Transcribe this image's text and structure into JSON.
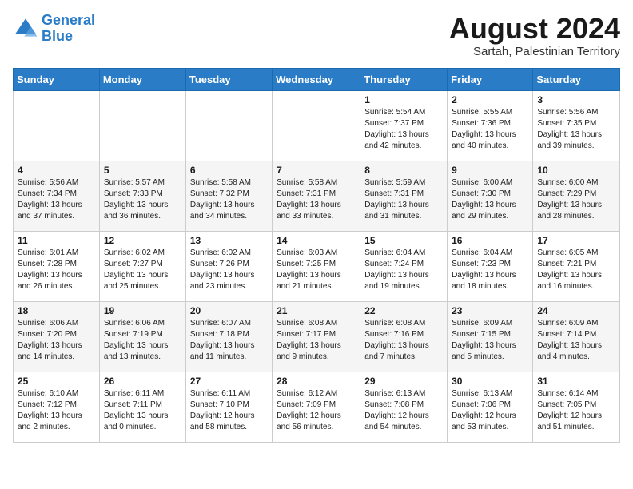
{
  "logo": {
    "line1": "General",
    "line2": "Blue"
  },
  "title": "August 2024",
  "subtitle": "Sartah, Palestinian Territory",
  "weekdays": [
    "Sunday",
    "Monday",
    "Tuesday",
    "Wednesday",
    "Thursday",
    "Friday",
    "Saturday"
  ],
  "weeks": [
    [
      {
        "day": "",
        "info": ""
      },
      {
        "day": "",
        "info": ""
      },
      {
        "day": "",
        "info": ""
      },
      {
        "day": "",
        "info": ""
      },
      {
        "day": "1",
        "info": "Sunrise: 5:54 AM\nSunset: 7:37 PM\nDaylight: 13 hours\nand 42 minutes."
      },
      {
        "day": "2",
        "info": "Sunrise: 5:55 AM\nSunset: 7:36 PM\nDaylight: 13 hours\nand 40 minutes."
      },
      {
        "day": "3",
        "info": "Sunrise: 5:56 AM\nSunset: 7:35 PM\nDaylight: 13 hours\nand 39 minutes."
      }
    ],
    [
      {
        "day": "4",
        "info": "Sunrise: 5:56 AM\nSunset: 7:34 PM\nDaylight: 13 hours\nand 37 minutes."
      },
      {
        "day": "5",
        "info": "Sunrise: 5:57 AM\nSunset: 7:33 PM\nDaylight: 13 hours\nand 36 minutes."
      },
      {
        "day": "6",
        "info": "Sunrise: 5:58 AM\nSunset: 7:32 PM\nDaylight: 13 hours\nand 34 minutes."
      },
      {
        "day": "7",
        "info": "Sunrise: 5:58 AM\nSunset: 7:31 PM\nDaylight: 13 hours\nand 33 minutes."
      },
      {
        "day": "8",
        "info": "Sunrise: 5:59 AM\nSunset: 7:31 PM\nDaylight: 13 hours\nand 31 minutes."
      },
      {
        "day": "9",
        "info": "Sunrise: 6:00 AM\nSunset: 7:30 PM\nDaylight: 13 hours\nand 29 minutes."
      },
      {
        "day": "10",
        "info": "Sunrise: 6:00 AM\nSunset: 7:29 PM\nDaylight: 13 hours\nand 28 minutes."
      }
    ],
    [
      {
        "day": "11",
        "info": "Sunrise: 6:01 AM\nSunset: 7:28 PM\nDaylight: 13 hours\nand 26 minutes."
      },
      {
        "day": "12",
        "info": "Sunrise: 6:02 AM\nSunset: 7:27 PM\nDaylight: 13 hours\nand 25 minutes."
      },
      {
        "day": "13",
        "info": "Sunrise: 6:02 AM\nSunset: 7:26 PM\nDaylight: 13 hours\nand 23 minutes."
      },
      {
        "day": "14",
        "info": "Sunrise: 6:03 AM\nSunset: 7:25 PM\nDaylight: 13 hours\nand 21 minutes."
      },
      {
        "day": "15",
        "info": "Sunrise: 6:04 AM\nSunset: 7:24 PM\nDaylight: 13 hours\nand 19 minutes."
      },
      {
        "day": "16",
        "info": "Sunrise: 6:04 AM\nSunset: 7:23 PM\nDaylight: 13 hours\nand 18 minutes."
      },
      {
        "day": "17",
        "info": "Sunrise: 6:05 AM\nSunset: 7:21 PM\nDaylight: 13 hours\nand 16 minutes."
      }
    ],
    [
      {
        "day": "18",
        "info": "Sunrise: 6:06 AM\nSunset: 7:20 PM\nDaylight: 13 hours\nand 14 minutes."
      },
      {
        "day": "19",
        "info": "Sunrise: 6:06 AM\nSunset: 7:19 PM\nDaylight: 13 hours\nand 13 minutes."
      },
      {
        "day": "20",
        "info": "Sunrise: 6:07 AM\nSunset: 7:18 PM\nDaylight: 13 hours\nand 11 minutes."
      },
      {
        "day": "21",
        "info": "Sunrise: 6:08 AM\nSunset: 7:17 PM\nDaylight: 13 hours\nand 9 minutes."
      },
      {
        "day": "22",
        "info": "Sunrise: 6:08 AM\nSunset: 7:16 PM\nDaylight: 13 hours\nand 7 minutes."
      },
      {
        "day": "23",
        "info": "Sunrise: 6:09 AM\nSunset: 7:15 PM\nDaylight: 13 hours\nand 5 minutes."
      },
      {
        "day": "24",
        "info": "Sunrise: 6:09 AM\nSunset: 7:14 PM\nDaylight: 13 hours\nand 4 minutes."
      }
    ],
    [
      {
        "day": "25",
        "info": "Sunrise: 6:10 AM\nSunset: 7:12 PM\nDaylight: 13 hours\nand 2 minutes."
      },
      {
        "day": "26",
        "info": "Sunrise: 6:11 AM\nSunset: 7:11 PM\nDaylight: 13 hours\nand 0 minutes."
      },
      {
        "day": "27",
        "info": "Sunrise: 6:11 AM\nSunset: 7:10 PM\nDaylight: 12 hours\nand 58 minutes."
      },
      {
        "day": "28",
        "info": "Sunrise: 6:12 AM\nSunset: 7:09 PM\nDaylight: 12 hours\nand 56 minutes."
      },
      {
        "day": "29",
        "info": "Sunrise: 6:13 AM\nSunset: 7:08 PM\nDaylight: 12 hours\nand 54 minutes."
      },
      {
        "day": "30",
        "info": "Sunrise: 6:13 AM\nSunset: 7:06 PM\nDaylight: 12 hours\nand 53 minutes."
      },
      {
        "day": "31",
        "info": "Sunrise: 6:14 AM\nSunset: 7:05 PM\nDaylight: 12 hours\nand 51 minutes."
      }
    ]
  ]
}
